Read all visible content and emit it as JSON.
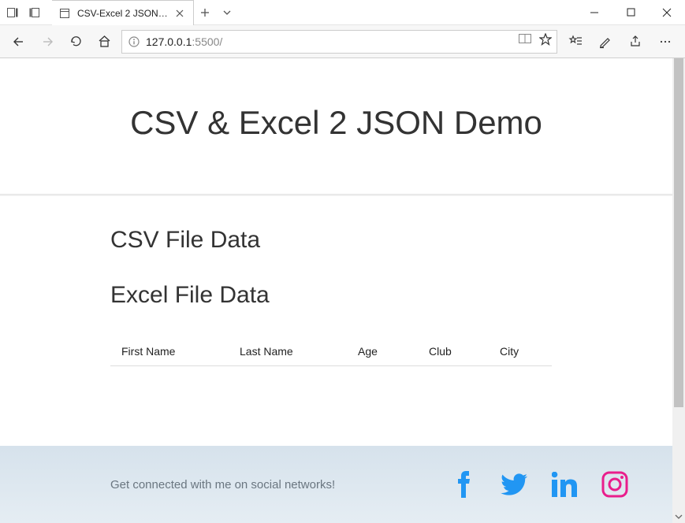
{
  "browser": {
    "tab_title": "CSV-Excel 2 JSON Demo",
    "url_host": "127.0.0.1",
    "url_port_path": ":5500/"
  },
  "page": {
    "hero_title": "CSV & Excel 2 JSON Demo",
    "section_csv_title": "CSV File Data",
    "section_excel_title": "Excel File Data",
    "table_headers": {
      "first_name": "First Name",
      "last_name": "Last Name",
      "age": "Age",
      "club": "Club",
      "city": "City"
    },
    "footer_text": "Get connected with me on social networks!"
  }
}
